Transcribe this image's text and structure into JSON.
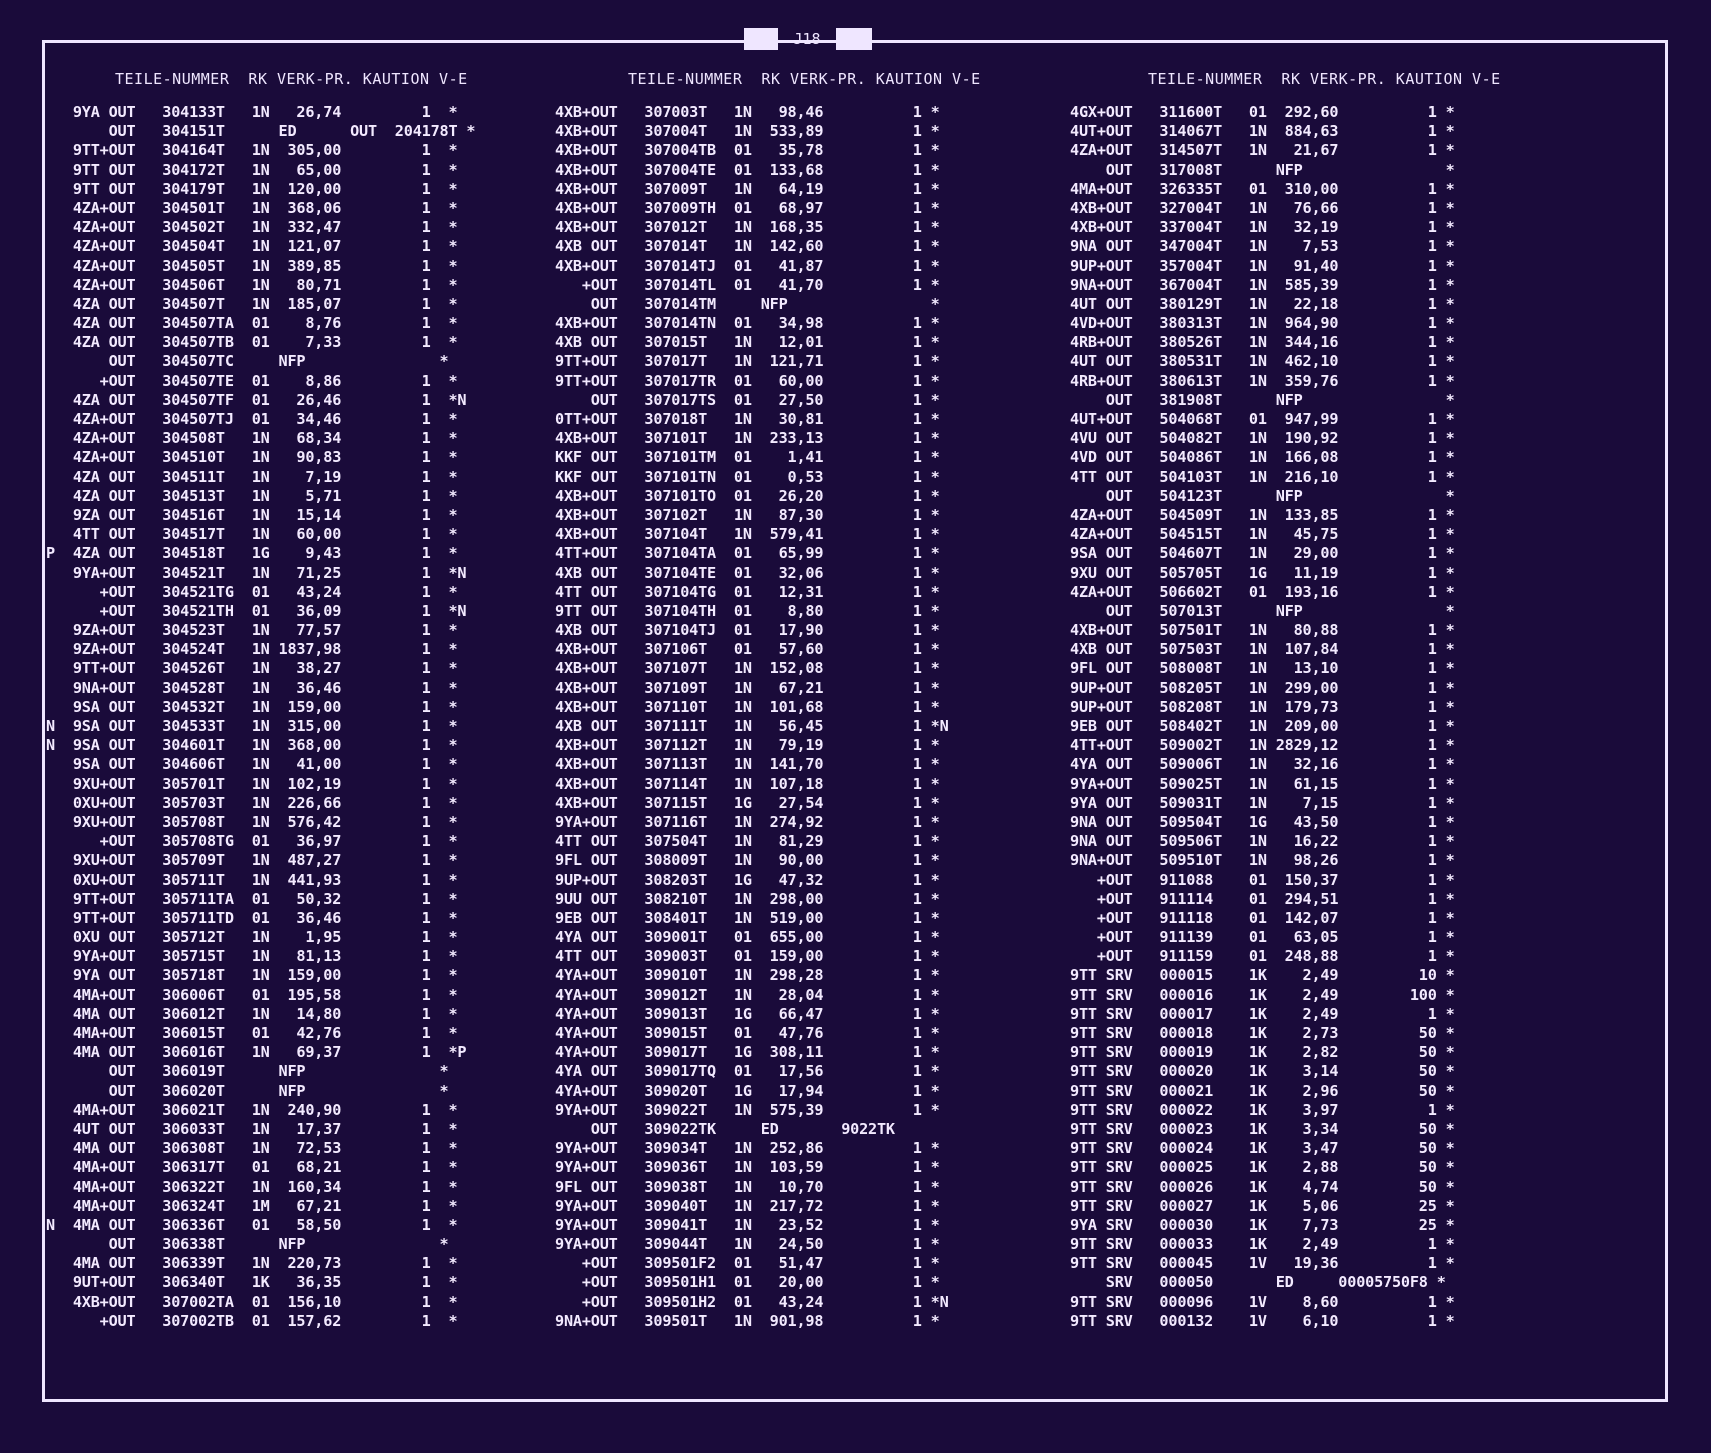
{
  "page": {
    "tab_label": "J18",
    "header": "TEILE-NUMMER  RK VERK-PR. KAUTION V-E",
    "marker": "*"
  },
  "columns": [
    {
      "rows": [
        "   9YA OUT   304133T   1N   26,74         1  *",
        "       OUT   304151T      ED      OUT  204178T *",
        "   9TT+OUT   304164T   1N  305,00         1  *",
        "   9TT OUT   304172T   1N   65,00         1  *",
        "   9TT OUT   304179T   1N  120,00         1  *",
        "   4ZA+OUT   304501T   1N  368,06         1  *",
        "   4ZA+OUT   304502T   1N  332,47         1  *",
        "   4ZA+OUT   304504T   1N  121,07         1  *",
        "   4ZA+OUT   304505T   1N  389,85         1  *",
        "   4ZA+OUT   304506T   1N   80,71         1  *",
        "   4ZA OUT   304507T   1N  185,07         1  *",
        "   4ZA OUT   304507TA  01    8,76         1  *",
        "   4ZA OUT   304507TB  01    7,33         1  *",
        "       OUT   304507TC     NFP               *",
        "      +OUT   304507TE  01    8,86         1  *",
        "   4ZA OUT   304507TF  01   26,46         1  *N",
        "   4ZA+OUT   304507TJ  01   34,46         1  *",
        "   4ZA+OUT   304508T   1N   68,34         1  *",
        "   4ZA+OUT   304510T   1N   90,83         1  *",
        "   4ZA OUT   304511T   1N    7,19         1  *",
        "   4ZA OUT   304513T   1N    5,71         1  *",
        "   9ZA OUT   304516T   1N   15,14         1  *",
        "   4TT OUT   304517T   1N   60,00         1  *",
        "P  4ZA OUT   304518T   1G    9,43         1  *",
        "   9YA+OUT   304521T   1N   71,25         1  *N",
        "      +OUT   304521TG  01   43,24         1  *",
        "      +OUT   304521TH  01   36,09         1  *N",
        "   9ZA+OUT   304523T   1N   77,57         1  *",
        "   9ZA+OUT   304524T   1N 1837,98         1  *",
        "   9TT+OUT   304526T   1N   38,27         1  *",
        "   9NA+OUT   304528T   1N   36,46         1  *",
        "   9SA OUT   304532T   1N  159,00         1  *",
        "N  9SA OUT   304533T   1N  315,00         1  *",
        "N  9SA OUT   304601T   1N  368,00         1  *",
        "   9SA OUT   304606T   1N   41,00         1  *",
        "   9XU+OUT   305701T   1N  102,19         1  *",
        "   0XU+OUT   305703T   1N  226,66         1  *",
        "   9XU+OUT   305708T   1N  576,42         1  *",
        "      +OUT   305708TG  01   36,97         1  *",
        "   9XU+OUT   305709T   1N  487,27         1  *",
        "   0XU+OUT   305711T   1N  441,93         1  *",
        "   9TT+OUT   305711TA  01   50,32         1  *",
        "   9TT+OUT   305711TD  01   36,46         1  *",
        "   0XU OUT   305712T   1N    1,95         1  *",
        "   9YA+OUT   305715T   1N   81,13         1  *",
        "   9YA OUT   305718T   1N  159,00         1  *",
        "   4MA+OUT   306006T   01  195,58         1  *",
        "   4MA OUT   306012T   1N   14,80         1  *",
        "   4MA+OUT   306015T   01   42,76         1  *",
        "   4MA OUT   306016T   1N   69,37         1  *P",
        "       OUT   306019T      NFP               *",
        "       OUT   306020T      NFP               *",
        "   4MA+OUT   306021T   1N  240,90         1  *",
        "   4UT OUT   306033T   1N   17,37         1  *",
        "   4MA OUT   306308T   1N   72,53         1  *",
        "   4MA+OUT   306317T   01   68,21         1  *",
        "   4MA+OUT   306322T   1N  160,34         1  *",
        "   4MA+OUT   306324T   1M   67,21         1  *",
        "N  4MA OUT   306336T   01   58,50         1  *",
        "       OUT   306338T      NFP               *",
        "   4MA OUT   306339T   1N  220,73         1  *",
        "   9UT+OUT   306340T   1K   36,35         1  *",
        "   4XB+OUT   307002TA  01  156,10         1  *",
        "      +OUT   307002TB  01  157,62         1  *"
      ]
    },
    {
      "rows": [
        "4XB+OUT   307003T   1N   98,46          1 *",
        "4XB+OUT   307004T   1N  533,89          1 *",
        "4XB+OUT   307004TB  01   35,78          1 *",
        "4XB+OUT   307004TE  01  133,68          1 *",
        "4XB+OUT   307009T   1N   64,19          1 *",
        "4XB+OUT   307009TH  01   68,97          1 *",
        "4XB+OUT   307012T   1N  168,35          1 *",
        "4XB OUT   307014T   1N  142,60          1 *",
        "4XB+OUT   307014TJ  01   41,87          1 *",
        "   +OUT   307014TL  01   41,70          1 *",
        "    OUT   307014TM     NFP                *",
        "4XB+OUT   307014TN  01   34,98          1 *",
        "4XB OUT   307015T   1N   12,01          1 *",
        "9TT+OUT   307017T   1N  121,71          1 *",
        "9TT+OUT   307017TR  01   60,00          1 *",
        "    OUT   307017TS  01   27,50          1 *",
        "0TT+OUT   307018T   1N   30,81          1 *",
        "4XB+OUT   307101T   1N  233,13          1 *",
        "KKF OUT   307101TM  01    1,41          1 *",
        "KKF OUT   307101TN  01    0,53          1 *",
        "4XB+OUT   307101TO  01   26,20          1 *",
        "4XB+OUT   307102T   1N   87,30          1 *",
        "4XB+OUT   307104T   1N  579,41          1 *",
        "4TT+OUT   307104TA  01   65,99          1 *",
        "4XB OUT   307104TE  01   32,06          1 *",
        "4TT OUT   307104TG  01   12,31          1 *",
        "9TT OUT   307104TH  01    8,80          1 *",
        "4XB OUT   307104TJ  01   17,90          1 *",
        "4XB+OUT   307106T   01   57,60          1 *",
        "4XB+OUT   307107T   1N  152,08          1 *",
        "4XB+OUT   307109T   1N   67,21          1 *",
        "4XB+OUT   307110T   1N  101,68          1 *",
        "4XB OUT   307111T   1N   56,45          1 *N",
        "4XB+OUT   307112T   1N   79,19          1 *",
        "4XB+OUT   307113T   1N  141,70          1 *",
        "4XB+OUT   307114T   1N  107,18          1 *",
        "4XB+OUT   307115T   1G   27,54          1 *",
        "9YA+OUT   307116T   1N  274,92          1 *",
        "4TT OUT   307504T   1N   81,29          1 *",
        "9FL OUT   308009T   1N   90,00          1 *",
        "9UP+OUT   308203T   1G   47,32          1 *",
        "9UU OUT   308210T   1N  298,00          1 *",
        "9EB OUT   308401T   1N  519,00          1 *",
        "4YA OUT   309001T   01  655,00          1 *",
        "4TT OUT   309003T   01  159,00          1 *",
        "4YA+OUT   309010T   1N  298,28          1 *",
        "4YA+OUT   309012T   1N   28,04          1 *",
        "4YA+OUT   309013T   1G   66,47          1 *",
        "4YA+OUT   309015T   01   47,76          1 *",
        "4YA+OUT   309017T   1G  308,11          1 *",
        "4YA OUT   309017TQ  01   17,56          1 *",
        "4YA+OUT   309020T   1G   17,94          1 *",
        "9YA+OUT   309022T   1N  575,39          1 *",
        "    OUT   309022TK     ED       9022TK    ",
        "9YA+OUT   309034T   1N  252,86          1 *",
        "9YA+OUT   309036T   1N  103,59          1 *",
        "9FL OUT   309038T   1N   10,70          1 *",
        "9YA+OUT   309040T   1N  217,72          1 *",
        "9YA+OUT   309041T   1N   23,52          1 *",
        "9YA+OUT   309044T   1N   24,50          1 *",
        "   +OUT   309501F2  01   51,47          1 *",
        "   +OUT   309501H1  01   20,00          1 *",
        "   +OUT   309501H2  01   43,24          1 *N",
        "9NA+OUT   309501T   1N  901,98          1 *"
      ]
    },
    {
      "rows": [
        "4GX+OUT   311600T   01  292,60          1 *",
        "4UT+OUT   314067T   1N  884,63          1 *",
        "4ZA+OUT   314507T   1N   21,67          1 *",
        "    OUT   317008T      NFP                *",
        "4MA+OUT   326335T   01  310,00          1 *",
        "4XB+OUT   327004T   1N   76,66          1 *",
        "4XB+OUT   337004T   1N   32,19          1 *",
        "9NA OUT   347004T   1N    7,53          1 *",
        "9UP+OUT   357004T   1N   91,40          1 *",
        "9NA+OUT   367004T   1N  585,39          1 *",
        "4UT OUT   380129T   1N   22,18          1 *",
        "4VD+OUT   380313T   1N  964,90          1 *",
        "4RB+OUT   380526T   1N  344,16          1 *",
        "4UT OUT   380531T   1N  462,10          1 *",
        "4RB+OUT   380613T   1N  359,76          1 *",
        "    OUT   381908T      NFP                *",
        "4UT+OUT   504068T   01  947,99          1 *",
        "4VU OUT   504082T   1N  190,92          1 *",
        "4VD OUT   504086T   1N  166,08          1 *",
        "4TT OUT   504103T   1N  216,10          1 *",
        "    OUT   504123T      NFP                *",
        "4ZA+OUT   504509T   1N  133,85          1 *",
        "4ZA+OUT   504515T   1N   45,75          1 *",
        "9SA OUT   504607T   1N   29,00          1 *",
        "9XU OUT   505705T   1G   11,19          1 *",
        "4ZA+OUT   506602T   01  193,16          1 *",
        "    OUT   507013T      NFP                *",
        "4XB+OUT   507501T   1N   80,88          1 *",
        "4XB OUT   507503T   1N  107,84          1 *",
        "9FL OUT   508008T   1N   13,10          1 *",
        "9UP+OUT   508205T   1N  299,00          1 *",
        "9UP+OUT   508208T   1N  179,73          1 *",
        "9EB OUT   508402T   1N  209,00          1 *",
        "4TT+OUT   509002T   1N 2829,12          1 *",
        "4YA OUT   509006T   1N   32,16          1 *",
        "9YA+OUT   509025T   1N   61,15          1 *",
        "9YA OUT   509031T   1N    7,15          1 *",
        "9NA OUT   509504T   1G   43,50          1 *",
        "9NA OUT   509506T   1N   16,22          1 *",
        "9NA+OUT   509510T   1N   98,26          1 *",
        "   +OUT   911088    01  150,37          1 *",
        "   +OUT   911114    01  294,51          1 *",
        "   +OUT   911118    01  142,07          1 *",
        "   +OUT   911139    01   63,05          1 *",
        "   +OUT   911159    01  248,88          1 *",
        "9TT SRV   000015    1K    2,49         10 *",
        "9TT SRV   000016    1K    2,49        100 *",
        "9TT SRV   000017    1K    2,49          1 *",
        "9TT SRV   000018    1K    2,73         50 *",
        "9TT SRV   000019    1K    2,82         50 *",
        "9TT SRV   000020    1K    3,14         50 *",
        "9TT SRV   000021    1K    2,96         50 *",
        "9TT SRV   000022    1K    3,97          1 *",
        "9TT SRV   000023    1K    3,34         50 *",
        "9TT SRV   000024    1K    3,47         50 *",
        "9TT SRV   000025    1K    2,88         50 *",
        "9TT SRV   000026    1K    4,74         50 *",
        "9TT SRV   000027    1K    5,06         25 *",
        "9YA SRV   000030    1K    7,73         25 *",
        "9TT SRV   000033    1K    2,49          1 *",
        "9TT SRV   000045    1V   19,36          1 *",
        "    SRV   000050       ED     00005750F8 *",
        "9TT SRV   000096    1V    8,60          1 *",
        "9TT SRV   000132    1V    6,10          1 *"
      ]
    }
  ]
}
